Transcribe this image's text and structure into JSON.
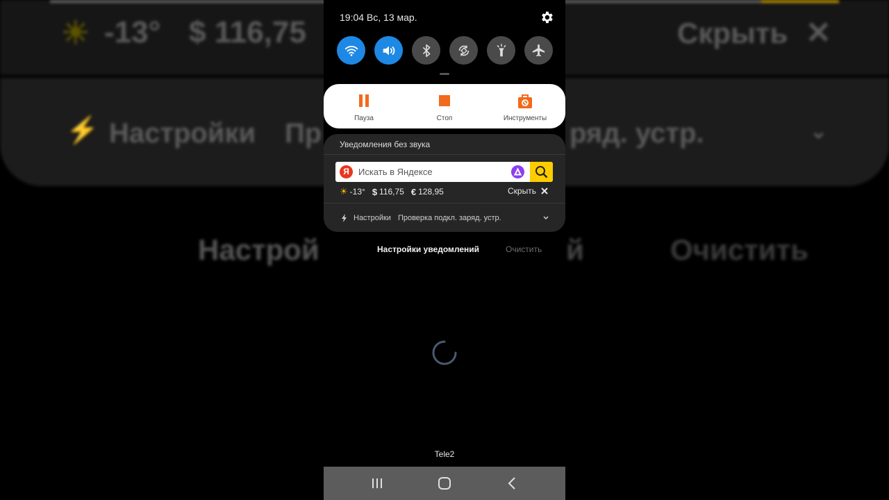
{
  "background": {
    "temp": "-13°",
    "usd": "$ 116,75",
    "hide": "Скрыть",
    "settings": "Настройки",
    "charge_prefix": "Пр",
    "charge_suffix": "ряд. устр.",
    "notif_settings": "Настрой",
    "clear": "Очистить"
  },
  "status_bar": {
    "datetime": "19:04 Вс, 13 мар."
  },
  "quick_settings": [
    {
      "name": "wifi",
      "icon": "wifi-icon",
      "state": "on"
    },
    {
      "name": "sound",
      "icon": "sound-icon",
      "state": "on"
    },
    {
      "name": "bluetooth",
      "icon": "bluetooth-icon",
      "state": "off"
    },
    {
      "name": "autorotate",
      "icon": "autorotate-icon",
      "state": "off"
    },
    {
      "name": "flashlight",
      "icon": "flashlight-icon",
      "state": "off"
    },
    {
      "name": "airplane",
      "icon": "airplane-icon",
      "state": "off"
    }
  ],
  "media": {
    "pause": "Пауза",
    "stop": "Стоп",
    "tools": "Инструменты",
    "accent": "#f26a1b"
  },
  "notification": {
    "header": "Уведомления без звука",
    "search_placeholder": "Искать в Яндексе",
    "yandex_letter": "Я",
    "temp": "-13°",
    "usd": "116,75",
    "eur": "128,95",
    "usd_symbol": "$",
    "eur_symbol": "€",
    "hide": "Скрыть",
    "settings": "Настройки",
    "charge_text": "Проверка подкл. заряд. устр."
  },
  "footer": {
    "notif_settings": "Настройки уведомлений",
    "clear": "Очистить",
    "carrier": "Tele2"
  },
  "colors": {
    "toggle_on": "#1e88e5",
    "toggle_off": "#4a4a4a",
    "search_button": "#ffcc00",
    "alice": "#8b3ef2",
    "yandex": "#e8361e"
  }
}
